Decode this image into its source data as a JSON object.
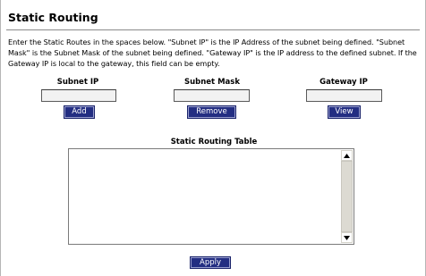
{
  "page": {
    "title": "Static Routing",
    "description": "Enter the Static Routes in the spaces below. \"Subnet IP\" is the IP Address of the subnet being defined. \"Subnet Mask\" is the Subnet Mask of the subnet being defined. \"Gateway IP\" is the IP address to the defined subnet. If the Gateway IP is local to the gateway, this field can be empty."
  },
  "fields": {
    "subnet_ip": {
      "label": "Subnet IP",
      "value": ""
    },
    "subnet_mask": {
      "label": "Subnet Mask",
      "value": ""
    },
    "gateway_ip": {
      "label": "Gateway IP",
      "value": ""
    }
  },
  "buttons": {
    "add": "Add",
    "remove": "Remove",
    "view": "View",
    "apply": "Apply"
  },
  "routing_table": {
    "title": "Static Routing Table",
    "entries": []
  },
  "colors": {
    "button_bg": "#232e82",
    "button_text": "#ffffff",
    "field_bg": "#f2f2f2"
  },
  "icons": {
    "scroll_up": "triangle-up",
    "scroll_down": "triangle-down"
  }
}
